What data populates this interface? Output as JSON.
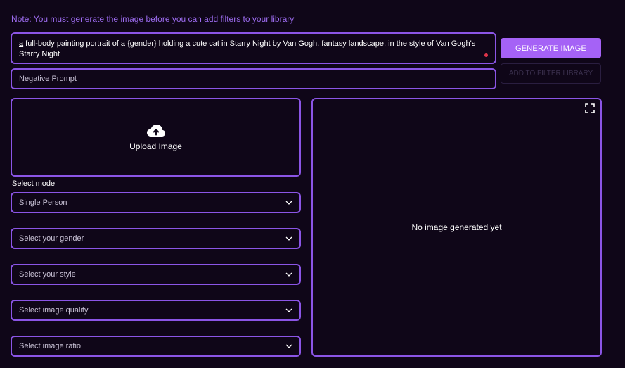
{
  "note": "Note: You must generate the image before you can add filters to your library",
  "prompt": {
    "first_word": "a",
    "rest": " full-body painting portrait of a {gender} holding a cute cat in Starry Night by Van Gogh, fantasy landscape, in the style of Van Gogh's Starry Night"
  },
  "negative_prompt": {
    "placeholder": "Negative Prompt"
  },
  "buttons": {
    "generate": "GENERATE IMAGE",
    "add_filter": "ADD TO FILTER LIBRARY"
  },
  "upload": {
    "label": "Upload Image"
  },
  "mode_label": "Select mode",
  "selects": {
    "mode": "Single Person",
    "gender": "Select your gender",
    "style": "Select your style",
    "quality": "Select image quality",
    "ratio": "Select image ratio"
  },
  "preview": {
    "empty_text": "No image generated yet"
  },
  "colors": {
    "background": "#0f0618",
    "accent": "#a562f6",
    "border": "#8b55e6",
    "note": "#9d6cf0"
  }
}
